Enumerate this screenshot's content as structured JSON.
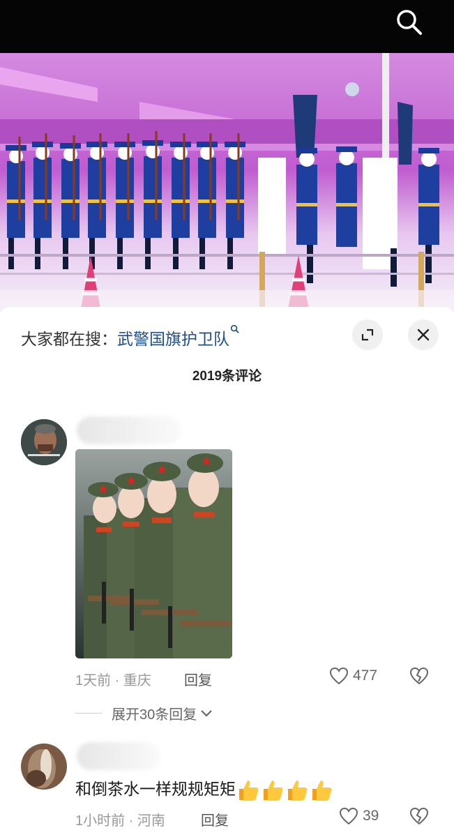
{
  "hot_search": {
    "label": "大家都在搜：",
    "keyword": "武警国旗护卫队"
  },
  "comments_header": {
    "count_label": "2019条评论"
  },
  "comments": [
    {
      "time_location": "1天前 · 重庆",
      "reply_label": "回复",
      "likes": "477",
      "expand_replies": "展开30条回复"
    },
    {
      "text": "和倒茶水一样规规矩矩",
      "time_location": "1小时前 · 河南",
      "reply_label": "回复",
      "likes": "39"
    }
  ],
  "icons": {
    "search": "search-icon",
    "expand": "expand-icon",
    "close": "close-icon",
    "like": "heart-icon",
    "dislike": "broken-heart-icon",
    "chevron": "chevron-down-icon",
    "thumbs_up": "thumbs-up-emoji"
  },
  "colors": {
    "keyword_link": "#1f4e8c",
    "top_bar": "#050505",
    "video_tint": "#c85fd6"
  }
}
